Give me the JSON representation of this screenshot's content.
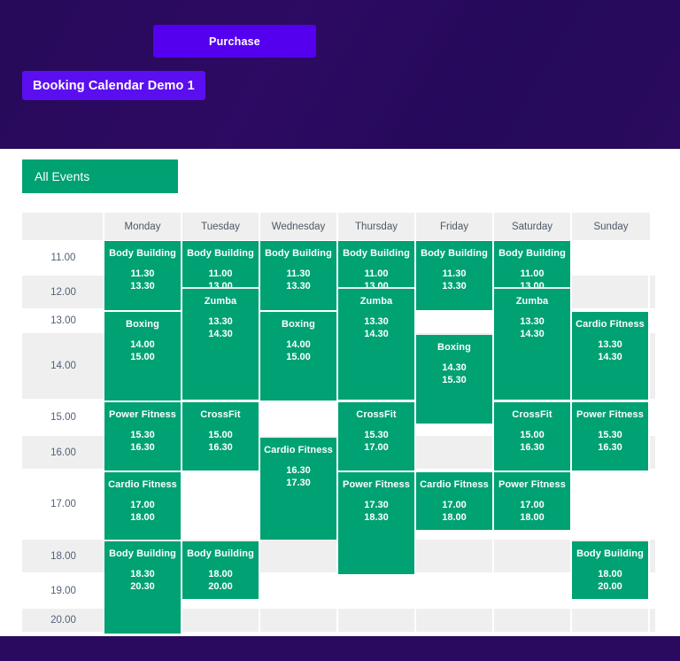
{
  "hero": {
    "purchase_label": "Purchase",
    "site_badge": "Booking Calendar Demo 1",
    "bg_color": "#2a0a5e",
    "button_color": "#5400ee"
  },
  "tabs": {
    "all_events_label": "All Events",
    "active_color": "#00a173"
  },
  "calendar": {
    "accent_color": "#00a173",
    "row_alt_color": "#efefef",
    "time_column_header": "",
    "day_headers": [
      "Monday",
      "Tuesday",
      "Wednesday",
      "Thursday",
      "Friday",
      "Saturday",
      "Sunday"
    ],
    "hours": [
      "11.00",
      "12.00",
      "13.00",
      "14.00",
      "15.00",
      "16.00",
      "17.00",
      "18.00",
      "19.00",
      "20.00"
    ],
    "events": [
      {
        "day": "Monday",
        "name": "Body Building",
        "start": "11.30",
        "end": "13.30"
      },
      {
        "day": "Monday",
        "name": "Boxing",
        "start": "14.00",
        "end": "15.00"
      },
      {
        "day": "Monday",
        "name": "Power Fitness",
        "start": "15.30",
        "end": "16.30"
      },
      {
        "day": "Monday",
        "name": "Cardio Fitness",
        "start": "17.00",
        "end": "18.00"
      },
      {
        "day": "Monday",
        "name": "Body Building",
        "start": "18.30",
        "end": "20.30"
      },
      {
        "day": "Tuesday",
        "name": "Body Building",
        "start": "11.00",
        "end": "13.00"
      },
      {
        "day": "Tuesday",
        "name": "Zumba",
        "start": "13.30",
        "end": "14.30"
      },
      {
        "day": "Tuesday",
        "name": "CrossFit",
        "start": "15.00",
        "end": "16.30"
      },
      {
        "day": "Tuesday",
        "name": "Body Building",
        "start": "18.00",
        "end": "20.00"
      },
      {
        "day": "Wednesday",
        "name": "Body Building",
        "start": "11.30",
        "end": "13.30"
      },
      {
        "day": "Wednesday",
        "name": "Boxing",
        "start": "14.00",
        "end": "15.00"
      },
      {
        "day": "Wednesday",
        "name": "Cardio Fitness",
        "start": "16.30",
        "end": "17.30"
      },
      {
        "day": "Thursday",
        "name": "Body Building",
        "start": "11.00",
        "end": "13.00"
      },
      {
        "day": "Thursday",
        "name": "Zumba",
        "start": "13.30",
        "end": "14.30"
      },
      {
        "day": "Thursday",
        "name": "CrossFit",
        "start": "15.30",
        "end": "17.00"
      },
      {
        "day": "Thursday",
        "name": "Power Fitness",
        "start": "17.30",
        "end": "18.30"
      },
      {
        "day": "Friday",
        "name": "Body Building",
        "start": "11.30",
        "end": "13.30"
      },
      {
        "day": "Friday",
        "name": "Boxing",
        "start": "14.30",
        "end": "15.30"
      },
      {
        "day": "Friday",
        "name": "Cardio Fitness",
        "start": "17.00",
        "end": "18.00"
      },
      {
        "day": "Saturday",
        "name": "Body Building",
        "start": "11.00",
        "end": "13.00"
      },
      {
        "day": "Saturday",
        "name": "Zumba",
        "start": "13.30",
        "end": "14.30"
      },
      {
        "day": "Saturday",
        "name": "CrossFit",
        "start": "15.00",
        "end": "16.30"
      },
      {
        "day": "Saturday",
        "name": "Power Fitness",
        "start": "17.00",
        "end": "18.00"
      },
      {
        "day": "Sunday",
        "name": "Cardio Fitness",
        "start": "13.30",
        "end": "14.30"
      },
      {
        "day": "Sunday",
        "name": "Power Fitness",
        "start": "15.30",
        "end": "16.30"
      },
      {
        "day": "Sunday",
        "name": "Body Building",
        "start": "18.00",
        "end": "20.00"
      }
    ]
  }
}
